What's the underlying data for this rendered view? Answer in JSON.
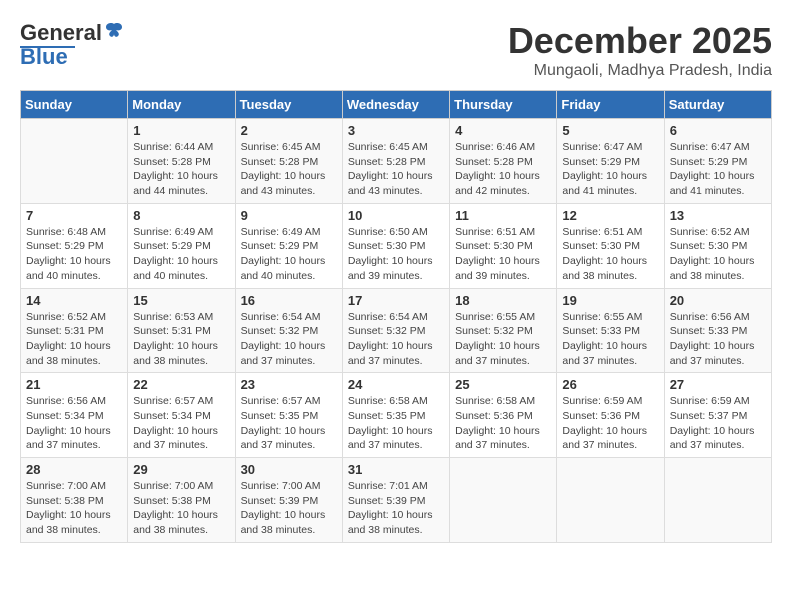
{
  "logo": {
    "text1": "General",
    "text2": "Blue"
  },
  "title": "December 2025",
  "location": "Mungaoli, Madhya Pradesh, India",
  "days_of_week": [
    "Sunday",
    "Monday",
    "Tuesday",
    "Wednesday",
    "Thursday",
    "Friday",
    "Saturday"
  ],
  "weeks": [
    [
      {
        "day": "",
        "info": ""
      },
      {
        "day": "1",
        "info": "Sunrise: 6:44 AM\nSunset: 5:28 PM\nDaylight: 10 hours\nand 44 minutes."
      },
      {
        "day": "2",
        "info": "Sunrise: 6:45 AM\nSunset: 5:28 PM\nDaylight: 10 hours\nand 43 minutes."
      },
      {
        "day": "3",
        "info": "Sunrise: 6:45 AM\nSunset: 5:28 PM\nDaylight: 10 hours\nand 43 minutes."
      },
      {
        "day": "4",
        "info": "Sunrise: 6:46 AM\nSunset: 5:28 PM\nDaylight: 10 hours\nand 42 minutes."
      },
      {
        "day": "5",
        "info": "Sunrise: 6:47 AM\nSunset: 5:29 PM\nDaylight: 10 hours\nand 41 minutes."
      },
      {
        "day": "6",
        "info": "Sunrise: 6:47 AM\nSunset: 5:29 PM\nDaylight: 10 hours\nand 41 minutes."
      }
    ],
    [
      {
        "day": "7",
        "info": "Sunrise: 6:48 AM\nSunset: 5:29 PM\nDaylight: 10 hours\nand 40 minutes."
      },
      {
        "day": "8",
        "info": "Sunrise: 6:49 AM\nSunset: 5:29 PM\nDaylight: 10 hours\nand 40 minutes."
      },
      {
        "day": "9",
        "info": "Sunrise: 6:49 AM\nSunset: 5:29 PM\nDaylight: 10 hours\nand 40 minutes."
      },
      {
        "day": "10",
        "info": "Sunrise: 6:50 AM\nSunset: 5:30 PM\nDaylight: 10 hours\nand 39 minutes."
      },
      {
        "day": "11",
        "info": "Sunrise: 6:51 AM\nSunset: 5:30 PM\nDaylight: 10 hours\nand 39 minutes."
      },
      {
        "day": "12",
        "info": "Sunrise: 6:51 AM\nSunset: 5:30 PM\nDaylight: 10 hours\nand 38 minutes."
      },
      {
        "day": "13",
        "info": "Sunrise: 6:52 AM\nSunset: 5:30 PM\nDaylight: 10 hours\nand 38 minutes."
      }
    ],
    [
      {
        "day": "14",
        "info": "Sunrise: 6:52 AM\nSunset: 5:31 PM\nDaylight: 10 hours\nand 38 minutes."
      },
      {
        "day": "15",
        "info": "Sunrise: 6:53 AM\nSunset: 5:31 PM\nDaylight: 10 hours\nand 38 minutes."
      },
      {
        "day": "16",
        "info": "Sunrise: 6:54 AM\nSunset: 5:32 PM\nDaylight: 10 hours\nand 37 minutes."
      },
      {
        "day": "17",
        "info": "Sunrise: 6:54 AM\nSunset: 5:32 PM\nDaylight: 10 hours\nand 37 minutes."
      },
      {
        "day": "18",
        "info": "Sunrise: 6:55 AM\nSunset: 5:32 PM\nDaylight: 10 hours\nand 37 minutes."
      },
      {
        "day": "19",
        "info": "Sunrise: 6:55 AM\nSunset: 5:33 PM\nDaylight: 10 hours\nand 37 minutes."
      },
      {
        "day": "20",
        "info": "Sunrise: 6:56 AM\nSunset: 5:33 PM\nDaylight: 10 hours\nand 37 minutes."
      }
    ],
    [
      {
        "day": "21",
        "info": "Sunrise: 6:56 AM\nSunset: 5:34 PM\nDaylight: 10 hours\nand 37 minutes."
      },
      {
        "day": "22",
        "info": "Sunrise: 6:57 AM\nSunset: 5:34 PM\nDaylight: 10 hours\nand 37 minutes."
      },
      {
        "day": "23",
        "info": "Sunrise: 6:57 AM\nSunset: 5:35 PM\nDaylight: 10 hours\nand 37 minutes."
      },
      {
        "day": "24",
        "info": "Sunrise: 6:58 AM\nSunset: 5:35 PM\nDaylight: 10 hours\nand 37 minutes."
      },
      {
        "day": "25",
        "info": "Sunrise: 6:58 AM\nSunset: 5:36 PM\nDaylight: 10 hours\nand 37 minutes."
      },
      {
        "day": "26",
        "info": "Sunrise: 6:59 AM\nSunset: 5:36 PM\nDaylight: 10 hours\nand 37 minutes."
      },
      {
        "day": "27",
        "info": "Sunrise: 6:59 AM\nSunset: 5:37 PM\nDaylight: 10 hours\nand 37 minutes."
      }
    ],
    [
      {
        "day": "28",
        "info": "Sunrise: 7:00 AM\nSunset: 5:38 PM\nDaylight: 10 hours\nand 38 minutes."
      },
      {
        "day": "29",
        "info": "Sunrise: 7:00 AM\nSunset: 5:38 PM\nDaylight: 10 hours\nand 38 minutes."
      },
      {
        "day": "30",
        "info": "Sunrise: 7:00 AM\nSunset: 5:39 PM\nDaylight: 10 hours\nand 38 minutes."
      },
      {
        "day": "31",
        "info": "Sunrise: 7:01 AM\nSunset: 5:39 PM\nDaylight: 10 hours\nand 38 minutes."
      },
      {
        "day": "",
        "info": ""
      },
      {
        "day": "",
        "info": ""
      },
      {
        "day": "",
        "info": ""
      }
    ]
  ]
}
